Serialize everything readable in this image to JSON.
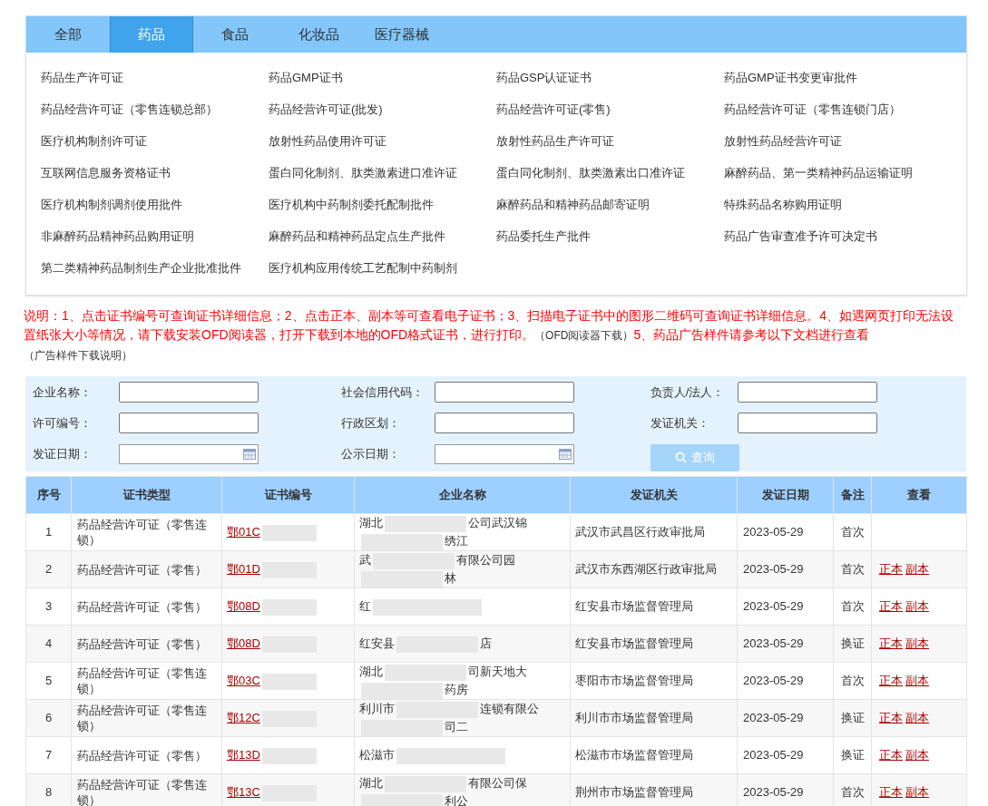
{
  "tabs": [
    {
      "label": "全部",
      "selected": false
    },
    {
      "label": "药品",
      "selected": true
    },
    {
      "label": "食品",
      "selected": false
    },
    {
      "label": "化妆品",
      "selected": false
    },
    {
      "label": "医疗器械",
      "selected": false
    }
  ],
  "categories": [
    "药品生产许可证",
    "药品GMP证书",
    "药品GSP认证证书",
    "药品GMP证书变更审批件",
    "药品经营许可证（零售连锁总部）",
    "药品经营许可证(批发)",
    "药品经营许可证(零售)",
    "药品经营许可证（零售连锁门店）",
    "医疗机构制剂许可证",
    "放射性药品使用许可证",
    "放射性药品生产许可证",
    "放射性药品经营许可证",
    "互联网信息服务资格证书",
    "蛋白同化制剂、肽类激素进口准许证",
    "蛋白同化制剂、肽类激素出口准许证",
    "麻醉药品、第一类精神药品运输证明",
    "医疗机构制剂调剂使用批件",
    "医疗机构中药制剂委托配制批件",
    "麻醉药品和精神药品邮寄证明",
    "特殊药品名称购用证明",
    "非麻醉药品精神药品购用证明",
    "麻醉药品和精神药品定点生产批件",
    "药品委托生产批件",
    "药品广告审查准予许可决定书",
    "第二类精神药品制剂生产企业批准批件",
    "医疗机构应用传统工艺配制中药制剂"
  ],
  "notice": [
    {
      "kind": "text",
      "text": "说明：1、点击证书编号可查询证书详细信息；2、点击正本、副本等可查看电子证书；3、扫描电子证书中的图形二维码可查询证书详细信息。4、如遇网页打印无法设置纸张大小等情况，请下载安装OFD阅读器，打开下载到本地的OFD格式证书，进行打印。"
    },
    {
      "kind": "link",
      "text": "（OFD阅读器下载）"
    },
    {
      "kind": "text",
      "text": "5、药品广告样件请参考以下文档进行查看"
    },
    {
      "kind": "link",
      "text": "（广告样件下载说明）"
    }
  ],
  "search": {
    "fields": [
      {
        "label": "企业名称：",
        "kind": "text"
      },
      {
        "label": "社会信用代码：",
        "kind": "text"
      },
      {
        "label": "负责人/法人：",
        "kind": "text"
      },
      {
        "label": "许可编号：",
        "kind": "text"
      },
      {
        "label": "行政区划：",
        "kind": "text"
      },
      {
        "label": "发证机关：",
        "kind": "text"
      },
      {
        "label": "发证日期：",
        "kind": "date"
      },
      {
        "label": "公示日期：",
        "kind": "date"
      }
    ],
    "button": "查询"
  },
  "table": {
    "columns": [
      "序号",
      "证书类型",
      "证书编号",
      "企业名称",
      "发证机关",
      "发证日期",
      "备注",
      "查看"
    ],
    "rows": [
      {
        "index": "1",
        "type": "药品经营许可证（零售连锁）",
        "number": "鄂01C",
        "company": [
          "湖北",
          "公司武汉锦",
          "绣江"
        ],
        "authority": "武汉市武昌区行政审批局",
        "date": "2023-05-29",
        "remark": "首次"
      },
      {
        "index": "2",
        "type": "药品经营许可证（零售）",
        "number": "鄂01D",
        "company": [
          "武",
          "有限公司园",
          "林"
        ],
        "authority": "武汉市东西湖区行政审批局",
        "date": "2023-05-29",
        "remark": "首次",
        "views": [
          "正本",
          "副本"
        ]
      },
      {
        "index": "3",
        "type": "药品经营许可证（零售）",
        "number": "鄂08D",
        "company": [
          "红"
        ],
        "authority": "红安县市场监督管理局",
        "date": "2023-05-29",
        "remark": "首次",
        "views": [
          "正本",
          "副本"
        ]
      },
      {
        "index": "4",
        "type": "药品经营许可证（零售）",
        "number": "鄂08D",
        "company": [
          "红安县",
          "店"
        ],
        "authority": "红安县市场监督管理局",
        "date": "2023-05-29",
        "remark": "换证",
        "views": [
          "正本",
          "副本"
        ]
      },
      {
        "index": "5",
        "type": "药品经营许可证（零售连锁）",
        "number": "鄂03C",
        "company": [
          "湖北",
          "司新天地大",
          "药房"
        ],
        "authority": "枣阳市市场监督管理局",
        "date": "2023-05-29",
        "remark": "首次",
        "views": [
          "正本",
          "副本"
        ]
      },
      {
        "index": "6",
        "type": "药品经营许可证（零售连锁）",
        "number": "鄂12C",
        "company": [
          "利川市",
          "连锁有限公",
          "司二"
        ],
        "authority": "利川市市场监督管理局",
        "date": "2023-05-29",
        "remark": "换证",
        "views": [
          "正本",
          "副本"
        ]
      },
      {
        "index": "7",
        "type": "药品经营许可证（零售）",
        "number": "鄂13D",
        "company": [
          "松滋市"
        ],
        "authority": "松滋市市场监督管理局",
        "date": "2023-05-29",
        "remark": "换证",
        "views": [
          "正本",
          "副本"
        ]
      },
      {
        "index": "8",
        "type": "药品经营许可证（零售连锁）",
        "number": "鄂13C",
        "company": [
          "湖北",
          "有限公司保",
          "利公"
        ],
        "authority": "荆州市市场监督管理局",
        "date": "2023-05-29",
        "remark": "首次",
        "views": [
          "正本",
          "副本"
        ]
      }
    ]
  }
}
